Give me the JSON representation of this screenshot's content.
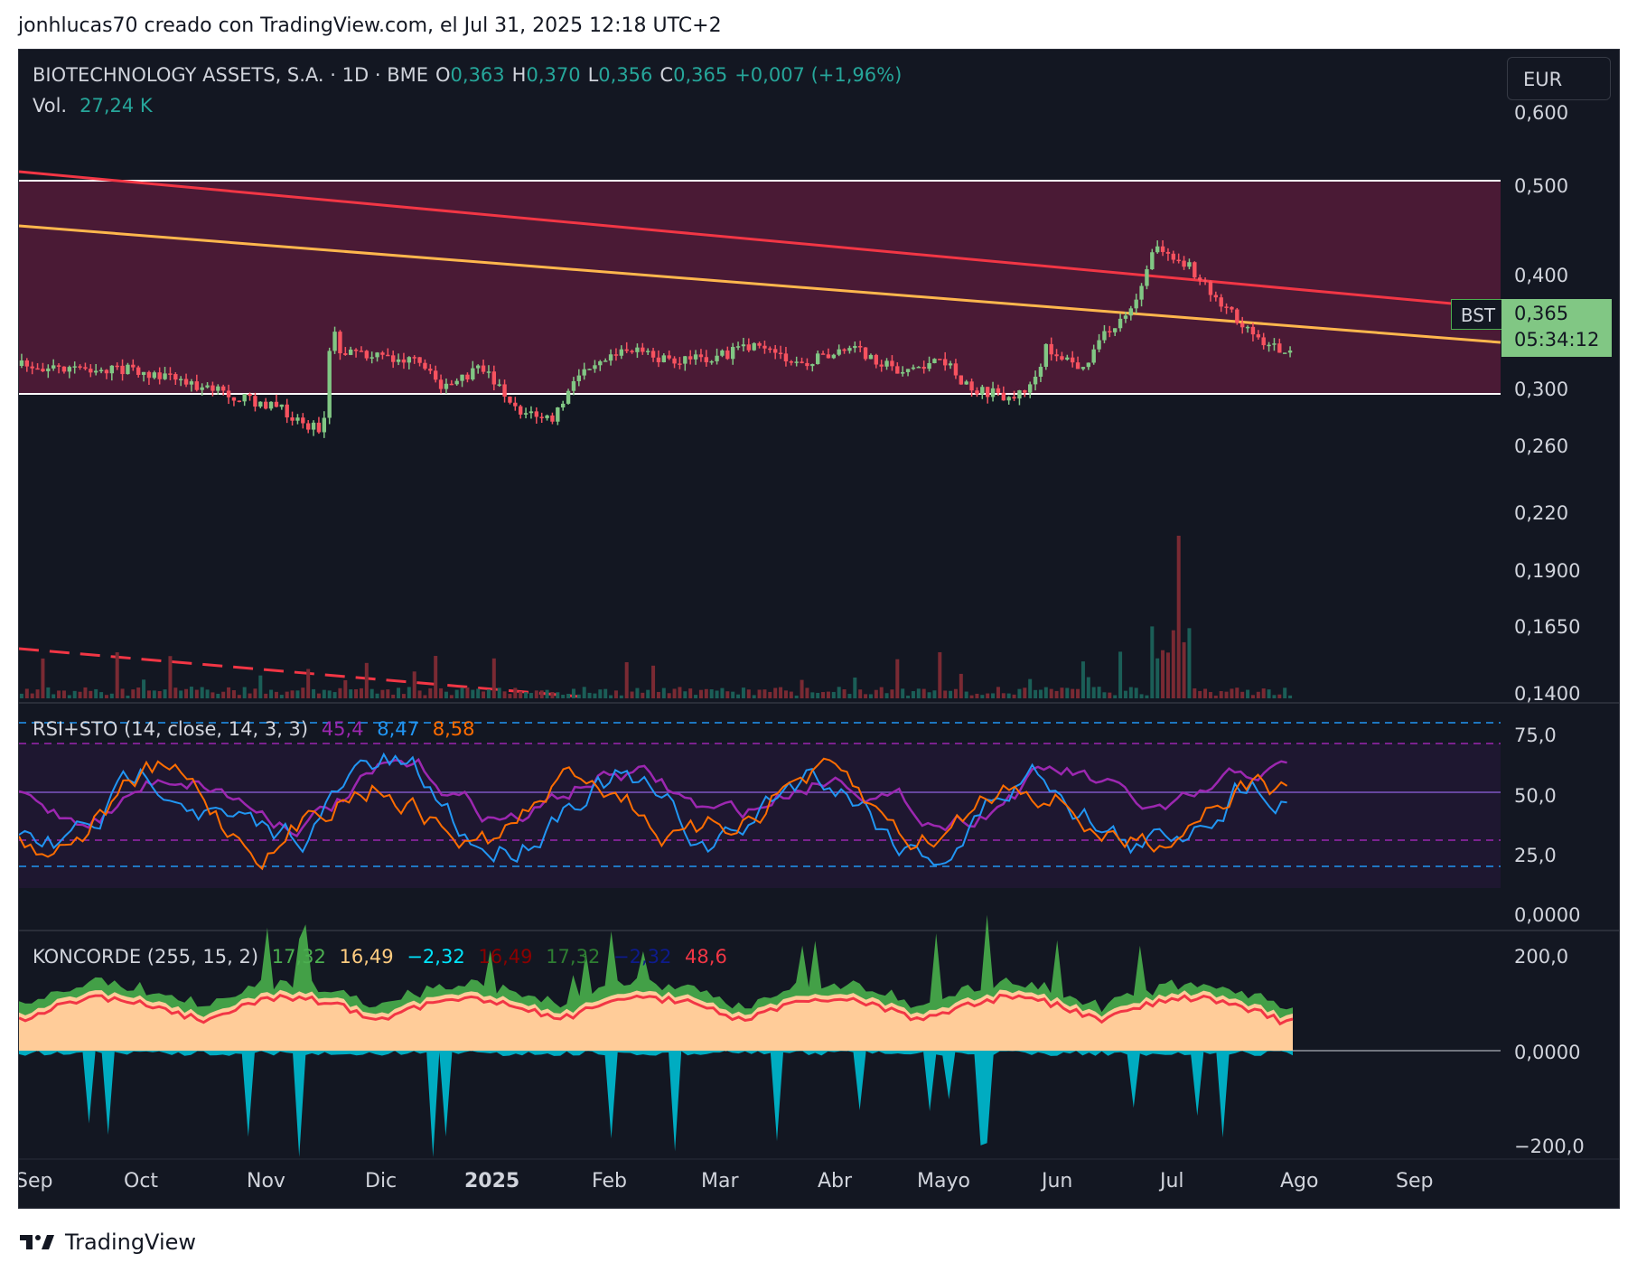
{
  "header": {
    "attribution": "jonhlucas70 creado con TradingView.com, el Jul 31, 2025 12:18 UTC+2"
  },
  "symbol": {
    "name": "BIOTECHNOLOGY ASSETS, S.A. · 1D · BME",
    "open_label": "O",
    "open": "0,363",
    "high_label": "H",
    "high": "0,370",
    "low_label": "L",
    "low": "0,356",
    "close_label": "C",
    "close": "0,365",
    "change": "+0,007 (+1,96%)",
    "ticker": "BST",
    "countdown": "05:34:12",
    "currency": "EUR"
  },
  "volume": {
    "label": "Vol.",
    "value": "27,24 K"
  },
  "rsi": {
    "title": "RSI+STO (14, close, 14, 3, 3)",
    "values": [
      "45,4",
      "8,47",
      "8,58"
    ],
    "colors": [
      "#9c27b0",
      "#2196f3",
      "#ff6d00"
    ]
  },
  "koncorde": {
    "title": "KONCORDE (255, 15, 2)",
    "values": [
      "17,32",
      "16,49",
      "−2,32",
      "16,49",
      "17,32",
      "−2,32",
      "48,6"
    ],
    "colors": [
      "#4caf50",
      "#ffcc80",
      "#00e5ff",
      "#8b0000",
      "#2e7d32",
      "#0d1b8c",
      "#f23645"
    ]
  },
  "price_axis": [
    "0,600",
    "0,500",
    "0,400",
    "0,300",
    "0,260",
    "0,220",
    "0,1900",
    "0,1650",
    "0,1400"
  ],
  "rsi_axis": [
    "75,0",
    "50,0",
    "25,0",
    "0,0000"
  ],
  "koncorde_axis": [
    "200,0",
    "0,0000",
    "−200,0"
  ],
  "time_axis": [
    "Sep",
    "Oct",
    "Nov",
    "Dic",
    "2025",
    "Feb",
    "Mar",
    "Abr",
    "Mayo",
    "Jun",
    "Jul",
    "Ago",
    "Sep"
  ],
  "footer": {
    "brand": "TradingView"
  },
  "colors": {
    "background": "#131722",
    "up": "#81c784",
    "down": "#f7525f",
    "zone": "#4a1a35",
    "red_line": "#f23645",
    "orange_line": "#ffb74d"
  }
}
